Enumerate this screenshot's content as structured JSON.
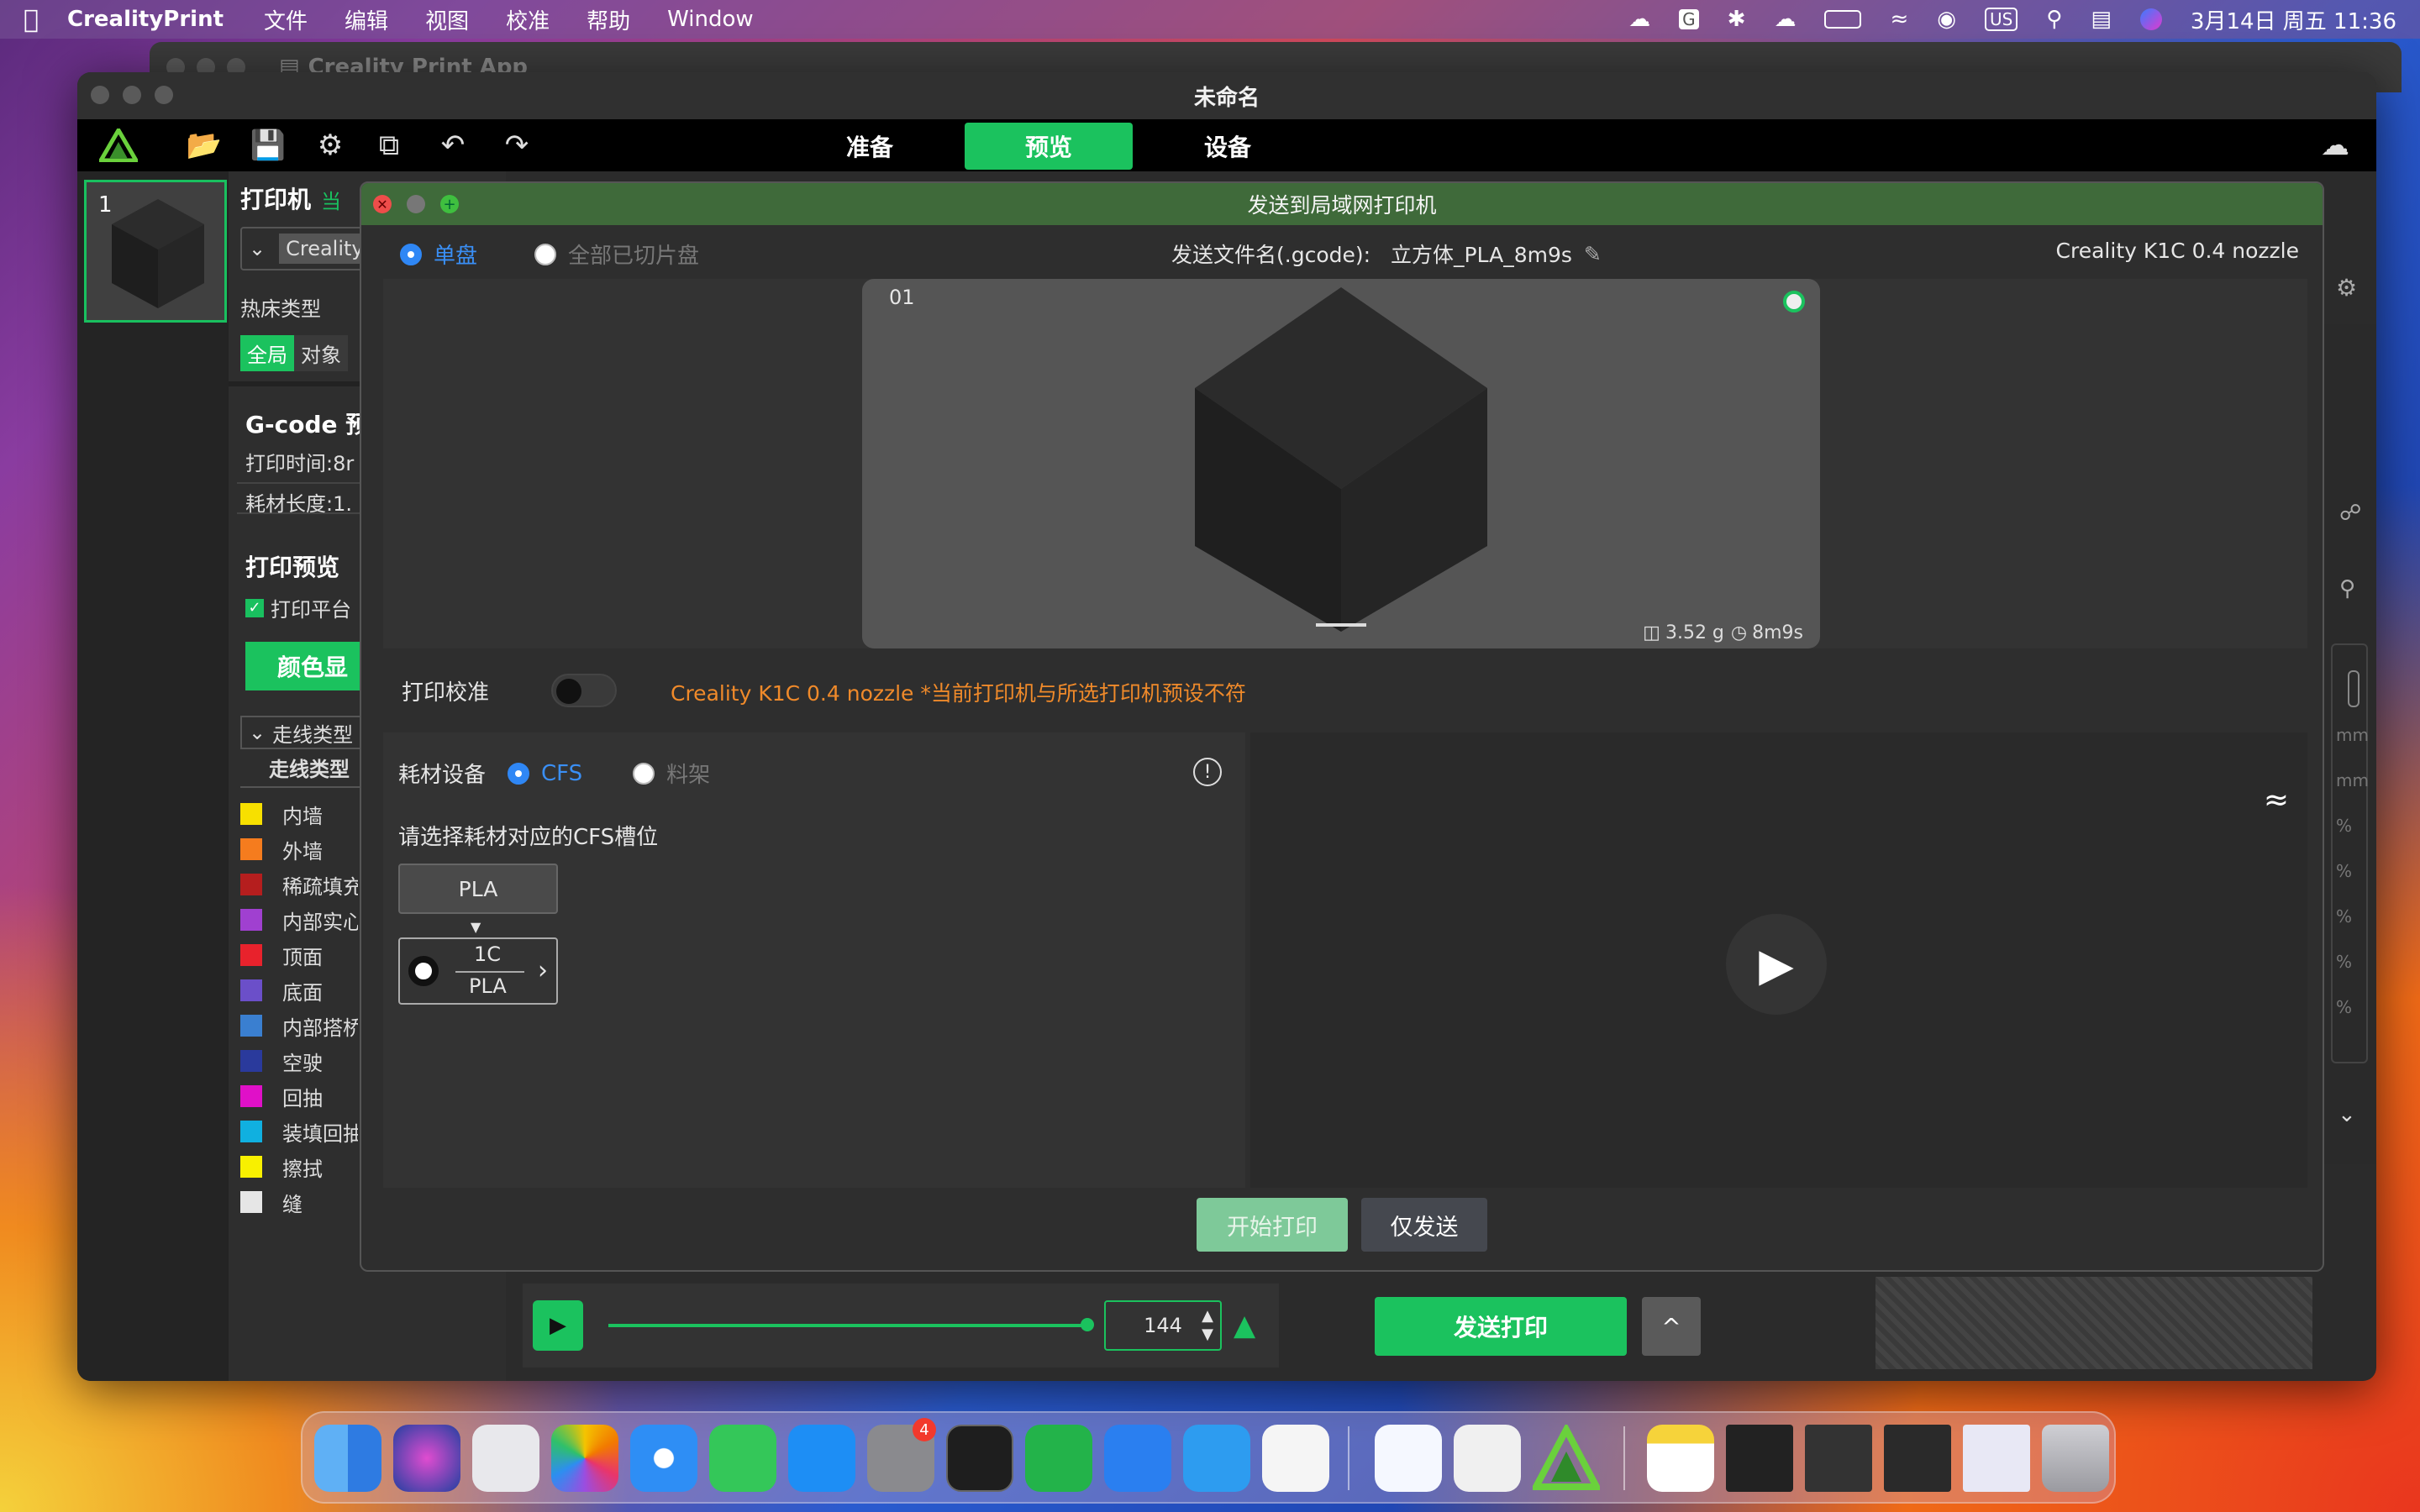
{
  "menubar": {
    "app_name": "CrealityPrint",
    "items": [
      "文件",
      "编辑",
      "视图",
      "校准",
      "帮助",
      "Window"
    ],
    "input_method": "US",
    "datetime": "3月14日 周五 11:36"
  },
  "background_window": {
    "title": "Creality Print App"
  },
  "window": {
    "title": "未命名"
  },
  "toolbar": {
    "tabs": [
      {
        "label": "准备",
        "active": false
      },
      {
        "label": "预览",
        "active": true
      },
      {
        "label": "设备",
        "active": false
      }
    ],
    "icons": [
      "logo-icon",
      "open-folder-icon",
      "save-icon",
      "settings-icon",
      "copy-icon",
      "undo-icon",
      "redo-icon",
      "cloud-upload-icon"
    ]
  },
  "plates": [
    {
      "number": "1"
    }
  ],
  "sidebar": {
    "printer_title": "打印机",
    "printer_badge": "当",
    "printer_select": "Creality",
    "bed_type_label": "热床类型",
    "scope_tabs": [
      "全局",
      "对象"
    ],
    "gcode_title": "G-code 预",
    "print_time": "打印时间:8r",
    "filament_length": "耗材长度:1.",
    "preview_title": "打印预览",
    "print_platform_label": "打印平台",
    "color_display_btn": "颜色显",
    "line_type_select": "走线类型",
    "line_type_header": "走线类型",
    "legend": [
      {
        "label": "内墙",
        "color": "#f7e000"
      },
      {
        "label": "外墙",
        "color": "#f57c1e"
      },
      {
        "label": "稀疏填充",
        "color": "#b51e1e"
      },
      {
        "label": "内部实心",
        "color": "#a040d0"
      },
      {
        "label": "顶面",
        "color": "#e8222c"
      },
      {
        "label": "底面",
        "color": "#6b4fc9"
      },
      {
        "label": "内部搭桥",
        "color": "#3a7fd0"
      },
      {
        "label": "空驶",
        "color": "#2a3a9c"
      },
      {
        "label": "回抽",
        "color": "#e010c8"
      },
      {
        "label": "装填回抽",
        "color": "#10b0e0"
      },
      {
        "label": "擦拭",
        "color": "#f8f000"
      },
      {
        "label": "缝",
        "color": "#e6e6e6"
      }
    ]
  },
  "dialog": {
    "title": "发送到局域网打印机",
    "plate_options": [
      {
        "label": "单盘",
        "selected": true
      },
      {
        "label": "全部已切片盘",
        "selected": false
      }
    ],
    "filename_label": "发送文件名(.gcode):",
    "filename": "立方体_PLA_8m9s",
    "printer_name": "Creality K1C 0.4 nozzle",
    "plate_preview": {
      "index": "01",
      "weight": "3.52 g",
      "time": "8m9s"
    },
    "calibration_label": "打印校准",
    "calibration_on": false,
    "warning": "Creality K1C 0.4 nozzle *当前打印机与所选打印机预设不符",
    "material_device_label": "耗材设备",
    "material_options": [
      {
        "label": "CFS",
        "selected": true
      },
      {
        "label": "料架",
        "selected": false
      }
    ],
    "slot_prompt": "请选择耗材对应的CFS槽位",
    "filament": "PLA",
    "slot": {
      "id": "1C",
      "material": "PLA"
    },
    "buttons": {
      "start_print": "开始打印",
      "send_only": "仅发送"
    }
  },
  "bottom_bar": {
    "layer_value": "144",
    "send_print": "发送打印",
    "expand": "^"
  },
  "right_panel": {
    "units": [
      "mm",
      "mm",
      "%",
      "%",
      "%",
      "%",
      "%"
    ]
  },
  "dock": {
    "badge_count": "4"
  }
}
